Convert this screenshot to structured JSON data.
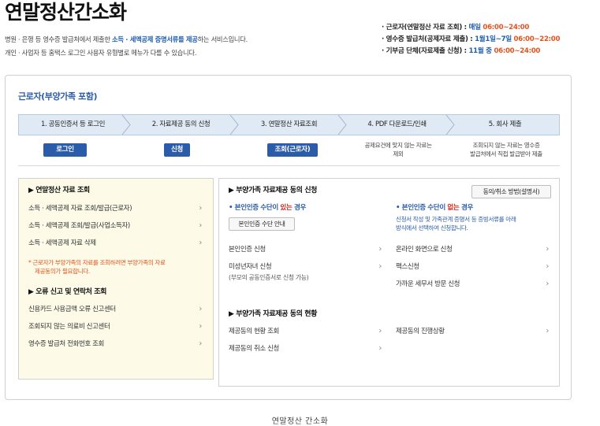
{
  "page": {
    "title": "연말정산간소화",
    "intro1_pre": "병원 · 은행 등 영수증 발급처에서 제출한 ",
    "intro1_hl": "소득 · 세액공제 증명서류를 제공",
    "intro1_post": "하는 서비스입니다.",
    "intro2": "개인 · 사업자 등 홈택스 로그인 사용자 유형별로 메뉴가 다를 수 있습니다."
  },
  "schedule": [
    {
      "label": "· 근로자(연말정산 자료 조회) : ",
      "days": "매일 ",
      "time": "06:00~24:00"
    },
    {
      "label": "· 영수증 발급처(공제자료 제출) : ",
      "days": "1월1일~7일 ",
      "time": "06:00~22:00"
    },
    {
      "label": "· 기부금 단체(자료제출 신청) : ",
      "days": "11월 중 ",
      "time": "06:00~24:00"
    }
  ],
  "panel_title": "근로자(부양가족 포함)",
  "steps": [
    {
      "label": "1. 공동인증서 등 로그인",
      "button": "로그인",
      "note1": "",
      "note2": ""
    },
    {
      "label": "2. 자료제공 동의 신청",
      "button": "신청",
      "note1": "",
      "note2": ""
    },
    {
      "label": "3. 연말정산 자료조회",
      "button": "조회(근로자)",
      "note1": "",
      "note2": ""
    },
    {
      "label": "4. PDF 다운로드/인쇄",
      "button": "",
      "note1": "공제요건에 맞지 않는 자료는",
      "note2": "제외"
    },
    {
      "label": "5. 회사 제출",
      "button": "",
      "note1": "조회되지 않는 자료는 영수증",
      "note2": "발급처에서 직접 발급받아 제출"
    }
  ],
  "left": {
    "sect1": "▶ 연말정산 자료 조회",
    "items1": [
      "소득 · 세액공제 자료 조회/발급(근로자)",
      "소득 · 세액공제 조회/발급(사업소득자)",
      "소득 · 세액공제 자료 삭제"
    ],
    "warn1": "* 근로자가 부양가족의 자료를 조회하려면 부양가족의 자료",
    "warn2": "제공동의가 필요합니다.",
    "sect2": "▶ 오류 신고 및 연락처 조회",
    "items2": [
      "신용카드 사용금액 오류 신고센터",
      "조회되지 않는 의료비 신고센터",
      "영수증 발급처 전화번호 조회"
    ]
  },
  "right": {
    "sect1": "▶ 부양가족 자료제공 동의 신청",
    "how_button": "동의/취소 방법(설명서)",
    "col1_head_pre": "• 본인인증 수단이 ",
    "col1_head_red": "있는",
    "col1_head_post": " 경우",
    "auth_button": "본인인증 수단 안내",
    "col1_items": [
      "본인인증 신청",
      "미성년자녀 신청"
    ],
    "col1_sub": "(부모의 공동인증서로 신청 가능)",
    "col2_head_pre": "• 본인인증 수단이 ",
    "col2_head_red": "없는",
    "col2_head_post": " 경우",
    "col2_note1": "신청서 작성 및 가족관계 증명서 등 증빙서류를 아래",
    "col2_note2": "방식에서 선택하여 신청합니다.",
    "col2_items": [
      "온라인 화면으로 신청",
      "팩스신청",
      "가까운 세무서 방문 신청"
    ],
    "sect2": "▶ 부양가족 자료제공 동의 현황",
    "status_col1": [
      "제공동의 현황 조회",
      "제공동의 취소 신청"
    ],
    "status_col2": [
      "제공동의 진행상황"
    ]
  },
  "caption": "연말정산 간소화",
  "colors": {
    "accent": "#2a5caa",
    "highlight": "#e2531d",
    "red": "#d7271a",
    "panel_bg": "#fdfbe8",
    "step_bg": "#dfeaf4"
  }
}
